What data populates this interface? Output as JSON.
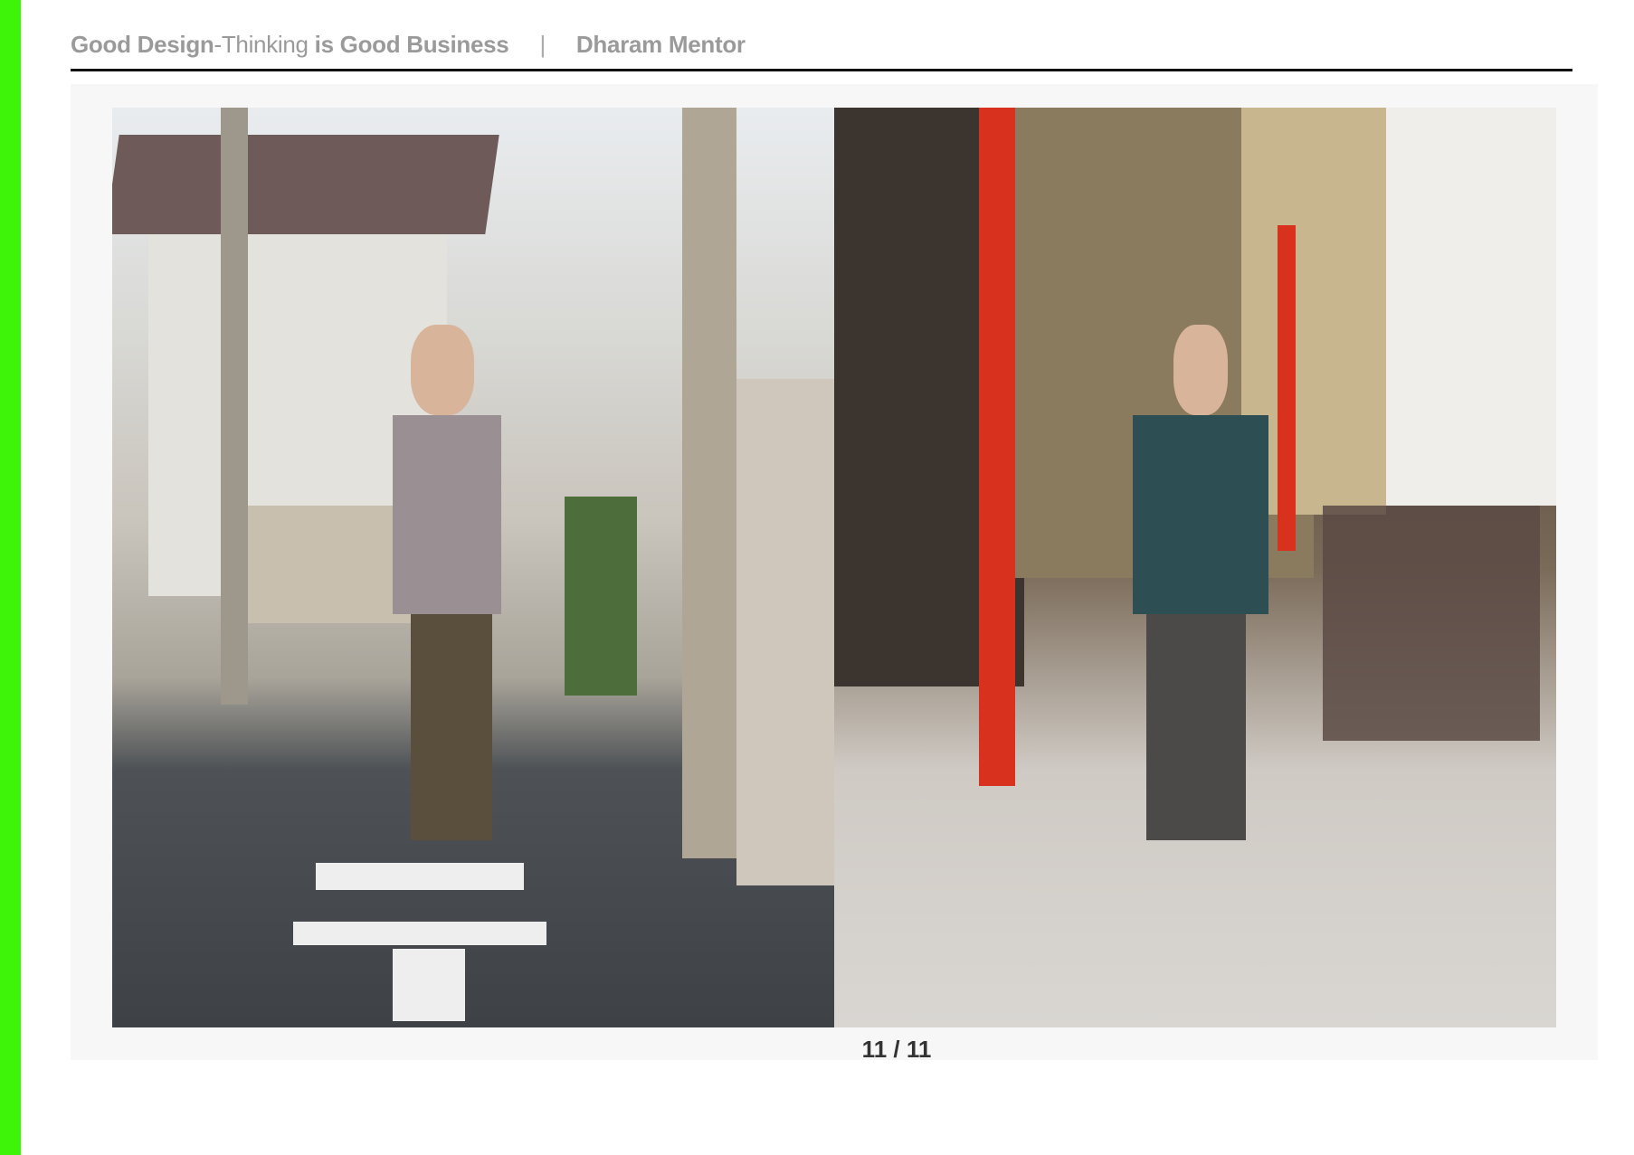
{
  "header": {
    "part1": "Good Design",
    "part2": "-Thinking",
    "part3": " is Good Business",
    "separator": "|",
    "author": "Dharam Mentor"
  },
  "photos": [
    {
      "name": "street-outfit-left"
    },
    {
      "name": "market-street-outfit-right"
    }
  ],
  "pagination": {
    "label": "11 / 11"
  },
  "colors": {
    "accent": "#3ef50a"
  }
}
